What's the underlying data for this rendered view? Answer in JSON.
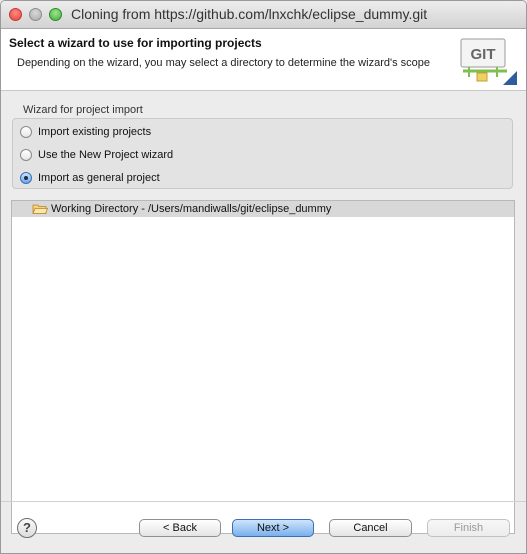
{
  "window": {
    "title": "Cloning from https://github.com/lnxchk/eclipse_dummy.git"
  },
  "header": {
    "title": "Select a wizard to use for importing projects",
    "description": "Depending on the wizard, you may select a directory to determine the wizard's scope",
    "logo_text": "GIT"
  },
  "wizard_group": {
    "label": "Wizard for project import",
    "options": [
      {
        "label": "Import existing projects",
        "selected": false
      },
      {
        "label": "Use the New Project wizard",
        "selected": false
      },
      {
        "label": "Import as general project",
        "selected": true
      }
    ]
  },
  "tree": {
    "items": [
      {
        "label": "Working Directory - /Users/mandiwalls/git/eclipse_dummy",
        "icon": "folder-open-icon"
      }
    ]
  },
  "buttons": {
    "back": "< Back",
    "next": "Next >",
    "cancel": "Cancel",
    "finish": "Finish",
    "help": "?"
  },
  "colors": {
    "primary_button": "#7ab0ec",
    "selection_row": "#d8d8d8",
    "close": "#e0443e",
    "minimize": "#a9a9a9",
    "maximize": "#3fae3b"
  }
}
